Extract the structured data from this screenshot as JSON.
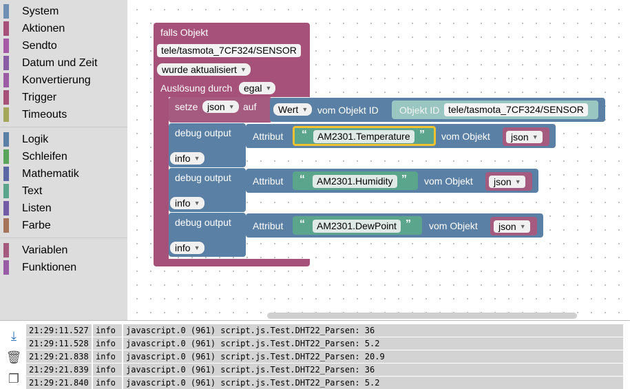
{
  "toolbox": {
    "groups": [
      {
        "items": [
          {
            "label": "System",
            "color": "#6d8fb3"
          },
          {
            "label": "Aktionen",
            "color": "#a5517a"
          },
          {
            "label": "Sendto",
            "color": "#a55ba5"
          },
          {
            "label": "Datum und Zeit",
            "color": "#8a5ba5"
          },
          {
            "label": "Konvertierung",
            "color": "#9b5ba5"
          },
          {
            "label": "Trigger",
            "color": "#a5517a"
          },
          {
            "label": "Timeouts",
            "color": "#a5a55b"
          }
        ]
      },
      {
        "items": [
          {
            "label": "Logik",
            "color": "#5b80a5"
          },
          {
            "label": "Schleifen",
            "color": "#5ba55b"
          },
          {
            "label": "Mathematik",
            "color": "#5b67a5"
          },
          {
            "label": "Text",
            "color": "#5ba58c"
          },
          {
            "label": "Listen",
            "color": "#745ba5"
          },
          {
            "label": "Farbe",
            "color": "#a5745b"
          }
        ]
      },
      {
        "items": [
          {
            "label": "Variablen",
            "color": "#a55b80"
          },
          {
            "label": "Funktionen",
            "color": "#995ba5"
          }
        ]
      }
    ]
  },
  "trigger_block": {
    "title": "falls Objekt",
    "object_id": "tele/tasmota_7CF324/SENSOR",
    "condition": "wurde aktualisiert",
    "trigger_label": "Auslösung durch",
    "trigger_value": "egal"
  },
  "set_block": {
    "label": "setze",
    "var": "json",
    "on": "auf",
    "value_kind": "Wert",
    "from_label": "vom Objekt ID",
    "objid_label": "Objekt ID",
    "objid_value": "tele/tasmota_7CF324/SENSOR"
  },
  "debug_blocks": [
    {
      "label": "debug output",
      "level": "info",
      "attr_label": "Attribut",
      "attr_value": "AM2301.Temperature",
      "from_label": "vom Objekt",
      "var": "json"
    },
    {
      "label": "debug output",
      "level": "info",
      "attr_label": "Attribut",
      "attr_value": "AM2301.Humidity",
      "from_label": "vom Objekt",
      "var": "json"
    },
    {
      "label": "debug output",
      "level": "info",
      "attr_label": "Attribut",
      "attr_value": "AM2301.DewPoint",
      "from_label": "vom Objekt",
      "var": "json"
    }
  ],
  "quotes": {
    "open": "“",
    "close": "”"
  },
  "log": {
    "rows": [
      {
        "time": "21:29:11.527",
        "level": "info",
        "msg": "javascript.0 (961) script.js.Test.DHT22_Parsen: 36"
      },
      {
        "time": "21:29:11.528",
        "level": "info",
        "msg": "javascript.0 (961) script.js.Test.DHT22_Parsen: 5.2"
      },
      {
        "time": "21:29:21.838",
        "level": "info",
        "msg": "javascript.0 (961) script.js.Test.DHT22_Parsen: 20.9"
      },
      {
        "time": "21:29:21.839",
        "level": "info",
        "msg": "javascript.0 (961) script.js.Test.DHT22_Parsen: 36"
      },
      {
        "time": "21:29:21.840",
        "level": "info",
        "msg": "javascript.0 (961) script.js.Test.DHT22_Parsen: 5.2"
      }
    ],
    "tools": [
      {
        "name": "scroll-down-icon",
        "glyph": "⤓"
      },
      {
        "name": "trash-icon",
        "glyph": "🗑"
      },
      {
        "name": "copy-icon",
        "glyph": "❐"
      }
    ]
  }
}
